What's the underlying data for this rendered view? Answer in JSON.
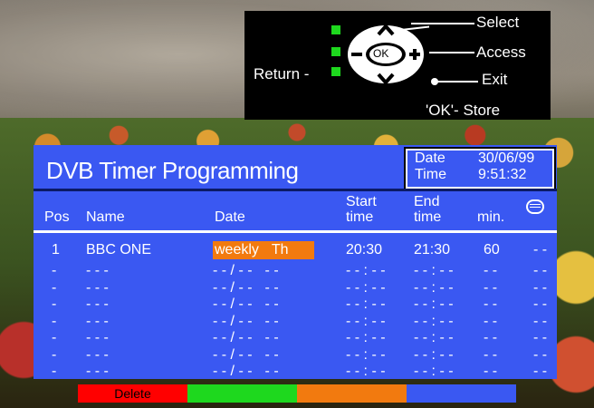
{
  "legend": {
    "select": "Select",
    "access": "Access",
    "exit": "Exit",
    "store": "'OK'- Store",
    "return": "Return -",
    "ok": "OK"
  },
  "window": {
    "title": "DVB Timer Programming",
    "date_label": "Date",
    "date_value": "30/06/99",
    "time_label": "Time",
    "time_value": "9:51:32"
  },
  "table": {
    "headers": {
      "pos": "Pos",
      "name": "Name",
      "date": "Date",
      "start_1": "Start",
      "start_2": "time",
      "end_1": "End",
      "end_2": "time",
      "min": "min."
    },
    "rows": [
      {
        "pos": "1",
        "name": "BBC ONE",
        "date_a": "weekly",
        "date_b": "Th",
        "start": "20:30",
        "end": "21:30",
        "min": "60",
        "tt": "- -"
      },
      {
        "pos": "-",
        "name": "- - -",
        "date_a": "- - / - -",
        "date_b": "- -",
        "start": "- - : - -",
        "end": "- - : - -",
        "min": "- -",
        "tt": "- -"
      },
      {
        "pos": "-",
        "name": "- - -",
        "date_a": "- - / - -",
        "date_b": "- -",
        "start": "- - : - -",
        "end": "- - : - -",
        "min": "- -",
        "tt": "- -"
      },
      {
        "pos": "-",
        "name": "- - -",
        "date_a": "- - / - -",
        "date_b": "- -",
        "start": "- - : - -",
        "end": "- - : - -",
        "min": "- -",
        "tt": "- -"
      },
      {
        "pos": "-",
        "name": "- - -",
        "date_a": "- - / - -",
        "date_b": "- -",
        "start": "- - : - -",
        "end": "- - : - -",
        "min": "- -",
        "tt": "- -"
      },
      {
        "pos": "-",
        "name": "- - -",
        "date_a": "- - / - -",
        "date_b": "- -",
        "start": "- - : - -",
        "end": "- - : - -",
        "min": "- -",
        "tt": "- -"
      },
      {
        "pos": "-",
        "name": "- - -",
        "date_a": "- - / - -",
        "date_b": "- -",
        "start": "- - : - -",
        "end": "- - : - -",
        "min": "- -",
        "tt": "- -"
      },
      {
        "pos": "-",
        "name": "- - -",
        "date_a": "- - / - -",
        "date_b": "- -",
        "start": "- - : - -",
        "end": "- - : - -",
        "min": "- -",
        "tt": "- -"
      }
    ]
  },
  "keys": {
    "red_label": "Delete",
    "green_label": "",
    "yellow_label": "",
    "blue_label": ""
  },
  "colors": {
    "panel_blue": "#3a58f2",
    "highlight_orange": "#f27a0f",
    "key_red": "#ff0000",
    "key_green": "#1ed81e",
    "key_yellow": "#f27a0f",
    "key_blue": "#3a58f2",
    "legend_green": "#1ed81e"
  }
}
